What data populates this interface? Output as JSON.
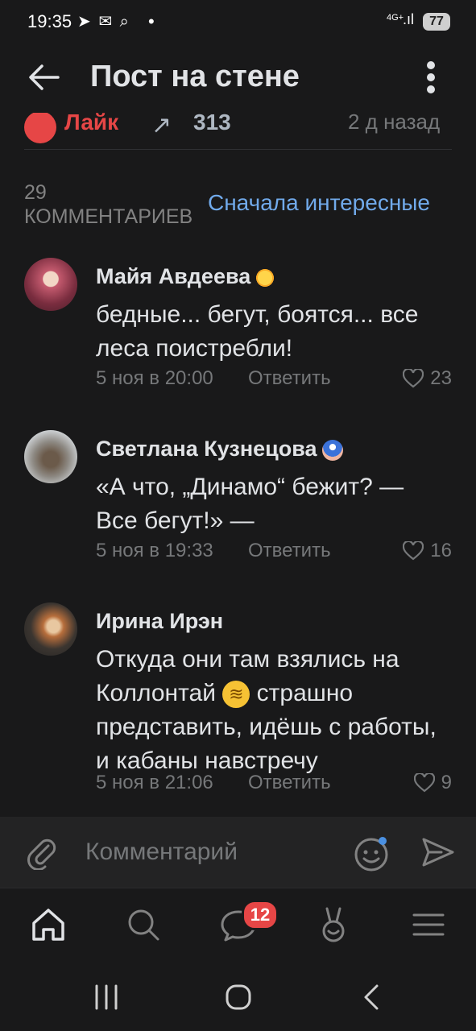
{
  "status_bar": {
    "time": "19:35",
    "left_icons": [
      "telegram-icon",
      "vk-icon",
      "search-icon"
    ],
    "network": "4G+",
    "battery": "77"
  },
  "header": {
    "title": "Пост на стене"
  },
  "post_actions": {
    "like_label": "Лайк",
    "shares": "313",
    "time": "2 д назад"
  },
  "comments_header": {
    "count_label": "29 КОММЕНТАРИЕВ",
    "sort_label": "Сначала интересные"
  },
  "comments": [
    {
      "author": "Майя Авдеева",
      "text": "бедные... бегут, боятся... все леса поистребли!",
      "date": "5 ноя в 20:00",
      "reply": "Ответить",
      "likes": "23"
    },
    {
      "author": "Светлана Кузнецова",
      "text": "«А что, „Динамо“ бежит? — Все бегут!» —",
      "date": "5 ноя в 19:33",
      "reply": "Ответить",
      "likes": "16"
    },
    {
      "author": "Ирина Ирэн",
      "text_part1": "Откуда они там взялись на Коллонтай",
      "text_part2": "страшно представить, идёшь с работы, и кабаны навстречу",
      "date": "5 ноя в 21:06",
      "reply": "Ответить",
      "likes": "9"
    }
  ],
  "comment_input": {
    "placeholder": "Комментарий"
  },
  "tab_bar": {
    "messages_badge": "12",
    "tabs": [
      "home-icon",
      "search-icon",
      "messages-icon",
      "clips-icon",
      "menu-icon"
    ]
  },
  "colors": {
    "background": "#19191a",
    "accent": "#71aaeb",
    "like": "#e64646",
    "secondary_text": "#76787a"
  }
}
